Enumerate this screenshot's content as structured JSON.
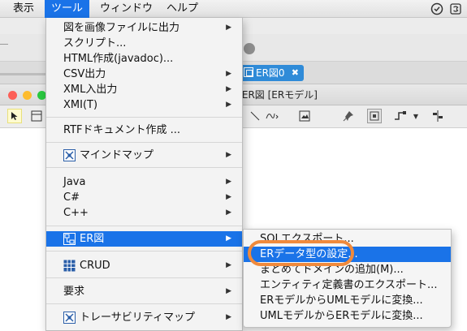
{
  "menubar": {
    "items": [
      "表示",
      "ツール",
      "ウィンドウ",
      "ヘルプ"
    ],
    "active_index": 1
  },
  "tab": {
    "label": "ER図0",
    "close": "✖"
  },
  "window": {
    "title": "/ ER図 [ERモデル]"
  },
  "tools_menu": {
    "items": [
      {
        "label": "図を画像ファイルに出力",
        "submenu": true
      },
      {
        "label": "スクリプト...",
        "submenu": false
      },
      {
        "label": "HTML作成(javadoc)...",
        "submenu": false
      },
      {
        "label": "CSV出力",
        "submenu": true
      },
      {
        "label": "XML入出力",
        "submenu": true
      },
      {
        "label": "XMI(T)",
        "submenu": true
      },
      {
        "label": "RTFドキュメント作成 ...",
        "submenu": false
      },
      {
        "label": "マインドマップ",
        "submenu": true,
        "icon": "mindmap-icon"
      },
      {
        "label": "Java",
        "submenu": true
      },
      {
        "label": "C#",
        "submenu": true
      },
      {
        "label": "C++",
        "submenu": true
      },
      {
        "label": "ER図",
        "submenu": true,
        "icon": "er-diagram-icon"
      },
      {
        "label": "CRUD",
        "submenu": true,
        "icon": "crud-grid-icon"
      },
      {
        "label": "要求",
        "submenu": true
      },
      {
        "label": "トレーサビリティマップ",
        "submenu": true,
        "icon": "traceability-map-icon"
      }
    ],
    "highlighted": "ER図"
  },
  "er_submenu": {
    "items": [
      "SQLエクスポート...",
      "ERデータ型の設定...",
      "まとめてドメインの追加(M)...",
      "エンティティ定義書のエクスポート...",
      "ERモデルからUMLモデルに変換...",
      "UMLモデルからERモデルに変換..."
    ],
    "highlighted": "ERデータ型の設定..."
  },
  "colors": {
    "highlight": "#1a73e8",
    "annotation_ring": "#f08a3c",
    "tab": "#2f8bd8"
  }
}
